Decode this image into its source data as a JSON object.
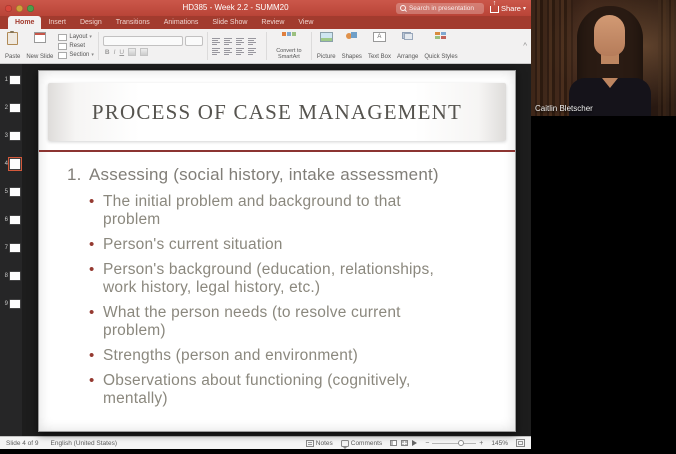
{
  "titlebar": {
    "title": "HD385 - Week 2.2 - SUMM20",
    "search_placeholder": "Search in presentation",
    "share_label": "Share"
  },
  "tabs": {
    "items": [
      "Home",
      "Insert",
      "Design",
      "Transitions",
      "Animations",
      "Slide Show",
      "Review",
      "View"
    ],
    "active": "Home"
  },
  "ribbon": {
    "paste": "Paste",
    "new_slide": "New Slide",
    "layout": "Layout",
    "reset": "Reset",
    "section": "Section",
    "bold": "B",
    "italic": "I",
    "underline": "U",
    "convert_smartart": "Convert to SmartArt",
    "picture": "Picture",
    "shapes": "Shapes",
    "text_box": "Text Box",
    "arrange": "Arrange",
    "quick_styles": "Quick Styles"
  },
  "thumbnails": {
    "numbers": [
      "1",
      "2",
      "3",
      "4",
      "5",
      "6",
      "7",
      "8",
      "9"
    ],
    "selected": "4"
  },
  "slide": {
    "title": "PROCESS OF CASE MANAGEMENT",
    "item_number": "1.",
    "item_text": "Assessing (social history, intake assessment)",
    "bullets": [
      "The initial problem and background to that problem",
      "Person's current situation",
      "Person's background (education, relationships, work history, legal history, etc.)",
      "What the person needs (to resolve current problem)",
      "Strengths (person and environment)",
      "Observations about functioning (cognitively, mentally)"
    ]
  },
  "statusbar": {
    "slide_info": "Slide 4 of 9",
    "language": "English (United States)",
    "notes_label": "Notes",
    "comments_label": "Comments",
    "zoom": "145%"
  },
  "webcam": {
    "participant_name": "Caitlin Bletscher"
  },
  "colors": {
    "titlebar_red": "#bf4a3d",
    "tab_bar_red": "#a23b2e",
    "slide_accent_maroon": "#8c3431",
    "bullet_maroon": "#953a31",
    "body_text_gray": "#8b887e"
  }
}
